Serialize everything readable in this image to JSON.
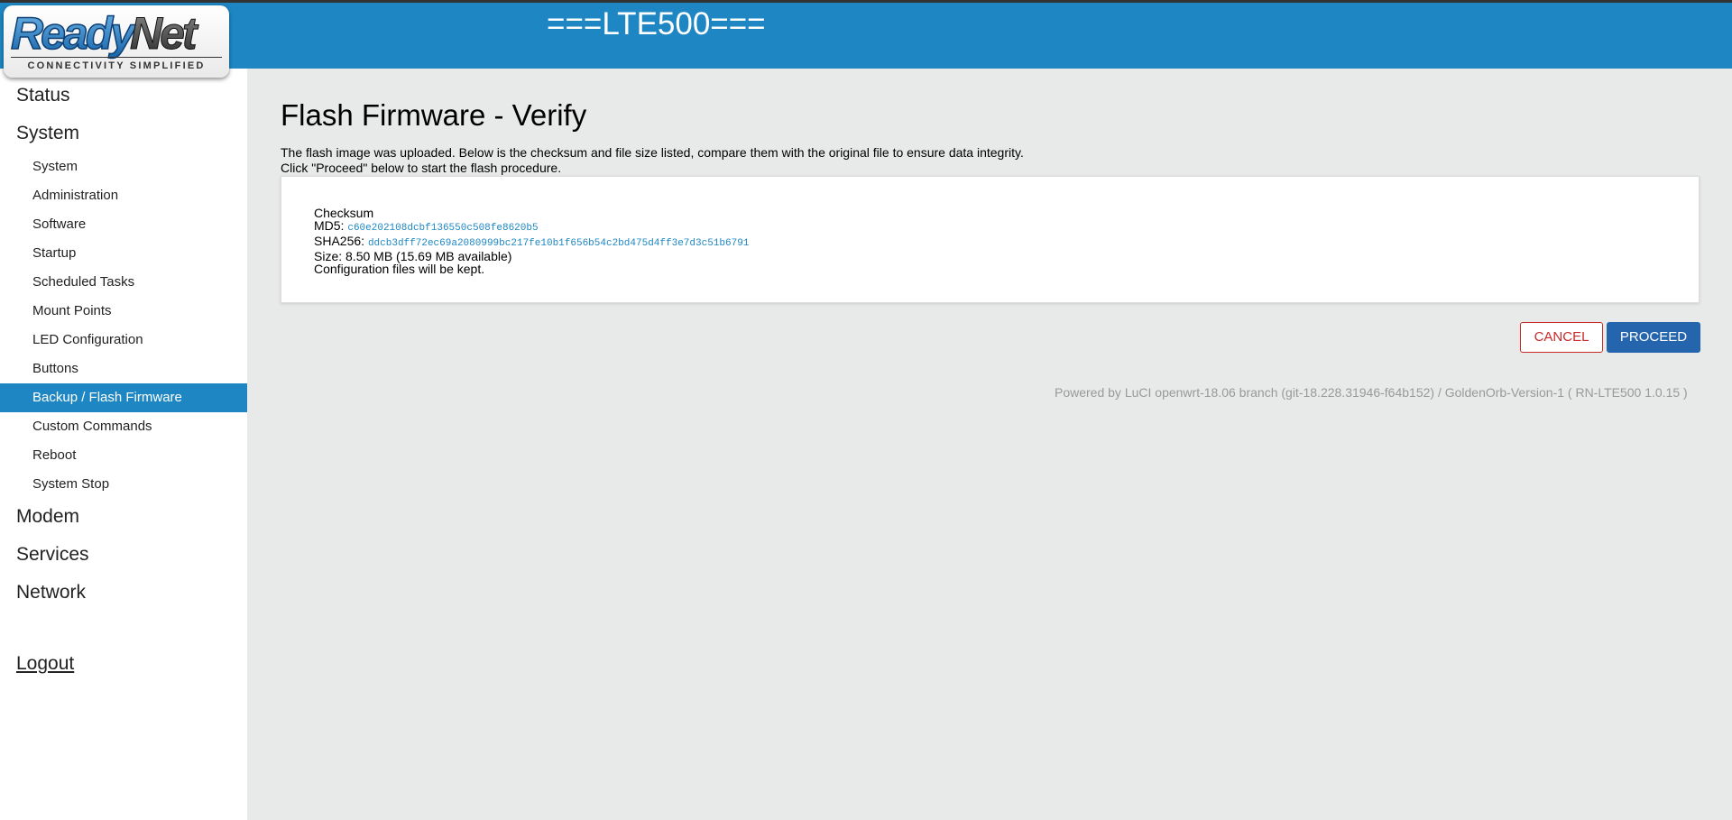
{
  "header": {
    "brand": "===LTE500===",
    "logo_text": "ReadyNet",
    "logo_tagline": "CONNECTIVITY SIMPLIFIED"
  },
  "sidebar": {
    "status": "Status",
    "system": "System",
    "system_items": [
      {
        "label": "System"
      },
      {
        "label": "Administration"
      },
      {
        "label": "Software"
      },
      {
        "label": "Startup"
      },
      {
        "label": "Scheduled Tasks"
      },
      {
        "label": "Mount Points"
      },
      {
        "label": "LED Configuration"
      },
      {
        "label": "Buttons"
      },
      {
        "label": "Backup / Flash Firmware",
        "active": true
      },
      {
        "label": "Custom Commands"
      },
      {
        "label": "Reboot"
      },
      {
        "label": "System Stop"
      }
    ],
    "modem": "Modem",
    "services": "Services",
    "network": "Network",
    "logout": "Logout"
  },
  "main": {
    "title": "Flash Firmware - Verify",
    "description_line1": "The flash image was uploaded. Below is the checksum and file size listed, compare them with the original file to ensure data integrity.",
    "description_line2": "Click \"Proceed\" below to start the flash procedure.",
    "checksum_label": "Checksum",
    "md5_label": "MD5:",
    "md5_value": "c60e202108dcbf136550c508fe8620b5",
    "sha256_label": "SHA256:",
    "sha256_value": "ddcb3dff72ec69a2080999bc217fe10b1f656b54c2bd475d4ff3e7d3c51b6791",
    "size_text": "Size: 8.50 MB (15.69 MB available)",
    "config_note": "Configuration files will be kept."
  },
  "buttons": {
    "cancel": "CANCEL",
    "proceed": "PROCEED"
  },
  "footer": {
    "text": "Powered by LuCI openwrt-18.06 branch (git-18.228.31946-f64b152) / GoldenOrb-Version-1 ( RN-LTE500 1.0.15 )"
  },
  "colors": {
    "header_blue": "#1e87c3",
    "proceed_blue": "#2565ad",
    "cancel_red": "#c82a2a",
    "background": "#e8e9e9"
  }
}
